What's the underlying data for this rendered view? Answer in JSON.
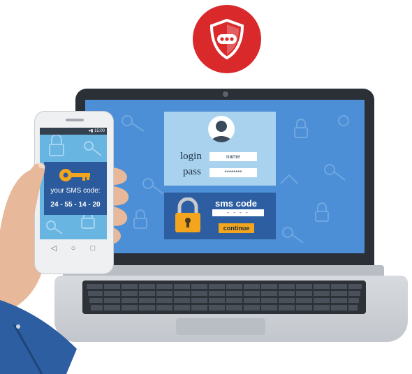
{
  "badge": {
    "icon": "shield-icon",
    "color": "#d9292b"
  },
  "laptop": {
    "login": {
      "label": "login",
      "value": "name"
    },
    "pass": {
      "label": "pass",
      "value": "********"
    },
    "sms": {
      "title": "sms code",
      "value": "- - - -"
    },
    "continue": "continue"
  },
  "phone": {
    "status_time": "▾▮ 15:00",
    "sms_label": "your SMS code:",
    "sms_code": "24 - 55 - 14 - 20",
    "nav": [
      "◁",
      "○",
      "□"
    ]
  },
  "colors": {
    "screen_bg": "#4d8fd6",
    "accent": "#f3a51e",
    "dark_blue": "#2c5b9d"
  }
}
